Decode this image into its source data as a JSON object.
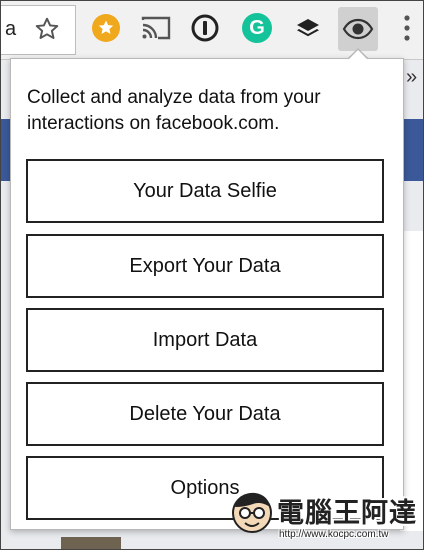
{
  "browser": {
    "url_fragment": "a",
    "overflow_label": "»",
    "extensions": [
      {
        "name": "bookmark-star-icon"
      },
      {
        "name": "favorites-extension-icon"
      },
      {
        "name": "cast-icon"
      },
      {
        "name": "1password-icon"
      },
      {
        "name": "grammarly-icon",
        "letter": "G"
      },
      {
        "name": "buffer-layers-icon"
      },
      {
        "name": "eye-extension-icon"
      },
      {
        "name": "chrome-menu-icon"
      }
    ]
  },
  "popup": {
    "description": "Collect and analyze data from your interactions on facebook.com.",
    "buttons": [
      "Your Data Selfie",
      "Export Your Data",
      "Import Data",
      "Delete Your Data",
      "Options"
    ]
  },
  "watermark": {
    "title": "電腦王阿達",
    "url": "http://www.kocpc.com.tw"
  },
  "colors": {
    "facebook_blue": "#3b5998",
    "grammarly_green": "#15c39a",
    "favorites_orange": "#f0a81c"
  }
}
